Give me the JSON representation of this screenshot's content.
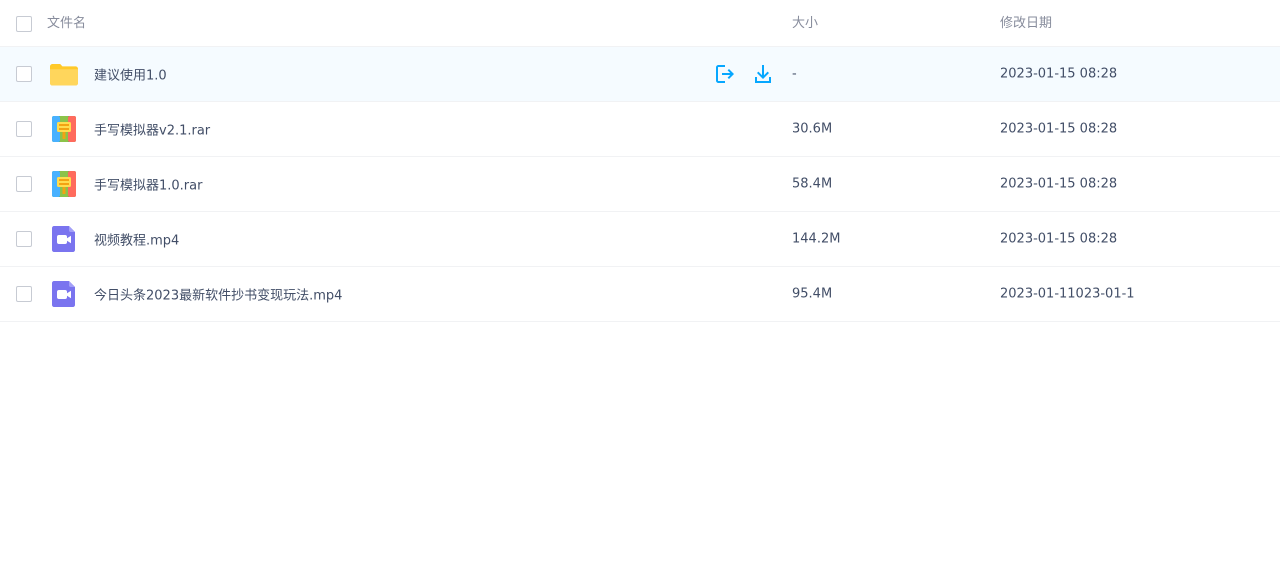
{
  "header": {
    "name_label": "文件名",
    "size_label": "大小",
    "date_label": "修改日期"
  },
  "files": [
    {
      "name": "建议使用1.0",
      "size": "-",
      "date": "2023-01-15 08:28",
      "icon": "folder-icon"
    },
    {
      "name": "手写模拟器v2.1.rar",
      "size": "30.6M",
      "date": "2023-01-15 08:28",
      "icon": "archive-icon"
    },
    {
      "name": "手写模拟器1.0.rar",
      "size": "58.4M",
      "date": "2023-01-15 08:28",
      "icon": "archive-icon"
    },
    {
      "name": "视频教程.mp4",
      "size": "144.2M",
      "date": "2023-01-15 08:28",
      "icon": "video-icon"
    },
    {
      "name": "今日头条2023最新软件抄书变现玩法.mp4",
      "size": "95.4M",
      "date": "2023-01-11023-01-1",
      "icon": "video-icon"
    }
  ],
  "row_actions": {
    "open_icon": "open-icon",
    "download_icon": "download-icon"
  },
  "colors": {
    "accent": "#06a7ff",
    "hover_row": "#f5fbff",
    "folder_yellow": "#ffd65c",
    "video_purple": "#7a74ef"
  }
}
